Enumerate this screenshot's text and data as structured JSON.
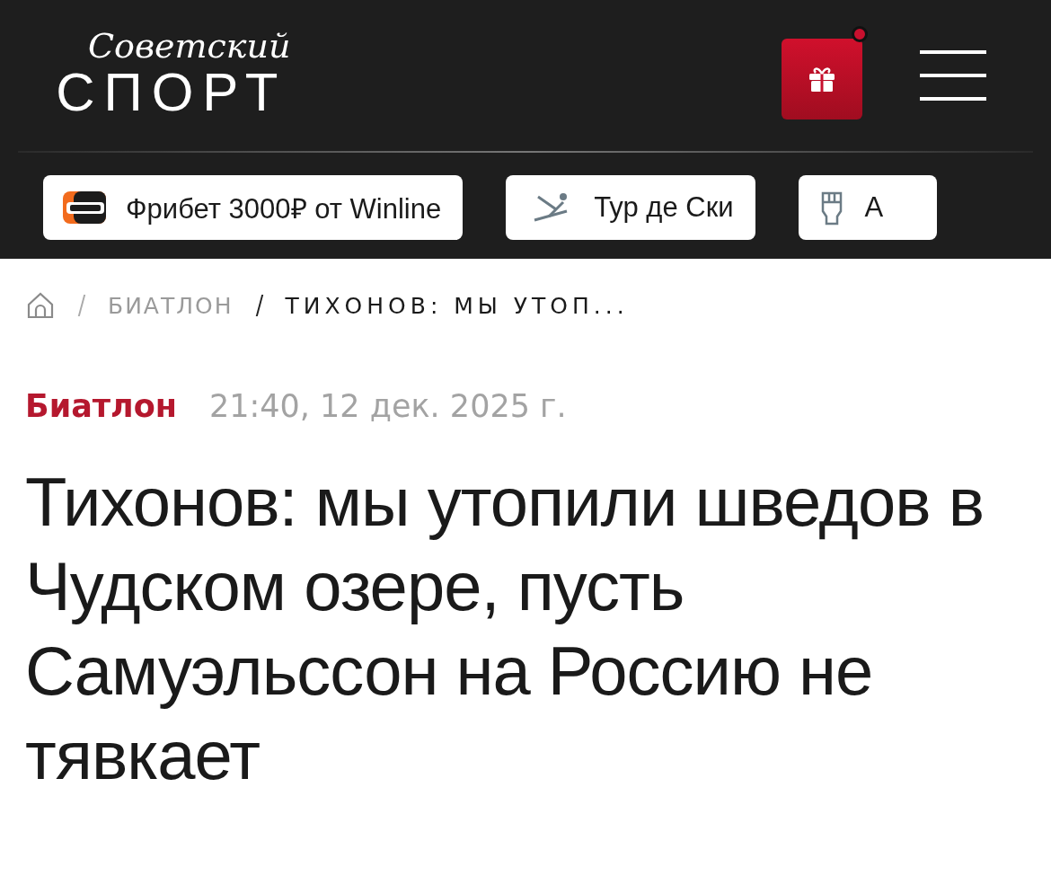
{
  "header": {
    "logo": {
      "script": "Советский",
      "main": "СПОРТ"
    },
    "gift_button": {
      "notification": true
    }
  },
  "chips": [
    {
      "kind": "winline",
      "label": "Фрибет 3000₽ от Winline"
    },
    {
      "kind": "ski",
      "label": "Тур де Ски"
    },
    {
      "kind": "glove",
      "label": "А"
    }
  ],
  "breadcrumb": [
    {
      "label": "БИАТЛОН"
    },
    {
      "label": "ТИХОНОВ: МЫ УТОП..."
    }
  ],
  "article": {
    "category": "Биатлон",
    "date": "21:40, 12 дек. 2025 г.",
    "title": "Тихонов: мы утопили шведов в Чудском озере, пусть Самуэльссон на Россию не тявкает"
  }
}
